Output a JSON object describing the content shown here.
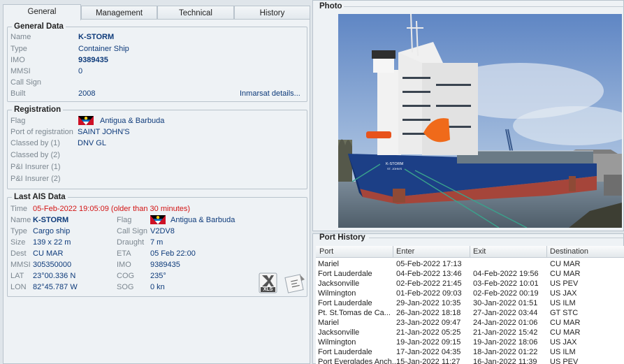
{
  "tabs": [
    "General",
    "Management",
    "Technical",
    "History"
  ],
  "general": {
    "legend": "General Data",
    "name_label": "Name",
    "name": "K-STORM",
    "type_label": "Type",
    "type": "Container Ship",
    "imo_label": "IMO",
    "imo": "9389435",
    "mmsi_label": "MMSI",
    "mmsi": "0",
    "callsign_label": "Call Sign",
    "callsign": "",
    "built_label": "Built",
    "built": "2008",
    "inmarsat_link": "Inmarsat details..."
  },
  "registration": {
    "legend": "Registration",
    "flag_label": "Flag",
    "flag": "Antigua & Barbuda",
    "port_label": "Port of registration",
    "port": "SAINT JOHN'S",
    "class1_label": "Classed by (1)",
    "class1": "DNV GL",
    "class2_label": "Classed by (2)",
    "class2": "",
    "pi1_label": "P&I Insurer (1)",
    "pi1": "",
    "pi2_label": "P&I Insurer (2)",
    "pi2": ""
  },
  "ais": {
    "legend": "Last AIS Data",
    "time_label": "Time",
    "time": "05-Feb-2022 19:05:09 (older than 30 minutes)",
    "name_label": "Name",
    "name": "K-STORM",
    "type_label": "Type",
    "type": "Cargo ship",
    "size_label": "Size",
    "size": "139 x 22 m",
    "dest_label": "Dest",
    "dest": "CU MAR",
    "mmsi_label": "MMSI",
    "mmsi": "305350000",
    "lat_label": "LAT",
    "lat": "23°00.336 N",
    "lon_label": "LON",
    "lon": "82°45.787 W",
    "flag_label": "Flag",
    "flag": "Antigua & Barbuda",
    "callsign_label": "Call Sign",
    "callsign": "V2DV8",
    "draught_label": "Draught",
    "draught": "7 m",
    "eta_label": "ETA",
    "eta": "05 Feb 22:00",
    "imo_label": "IMO",
    "imo": "9389435",
    "cog_label": "COG",
    "cog": "235°",
    "sog_label": "SOG",
    "sog": "0 kn",
    "xls_icon_label": "XLS"
  },
  "photo": {
    "header": "Photo",
    "hull_text": "K-STORM",
    "hull_port": "ST. JOHN'S"
  },
  "port_history": {
    "header": "Port History",
    "columns": [
      "Port",
      "Enter",
      "Exit",
      "Destination"
    ],
    "rows": [
      [
        "Mariel",
        "05-Feb-2022 17:13",
        "",
        "CU MAR"
      ],
      [
        "Fort Lauderdale",
        "04-Feb-2022 13:46",
        "04-Feb-2022 19:56",
        "CU MAR"
      ],
      [
        "Jacksonville",
        "02-Feb-2022 21:45",
        "03-Feb-2022 10:01",
        "US PEV"
      ],
      [
        "Wilmington",
        "01-Feb-2022 09:03",
        "02-Feb-2022 00:19",
        "US JAX"
      ],
      [
        "Fort Lauderdale",
        "29-Jan-2022 10:35",
        "30-Jan-2022 01:51",
        "US ILM"
      ],
      [
        "Pt. St.Tomas de Ca...",
        "26-Jan-2022 18:18",
        "27-Jan-2022 03:44",
        "GT STC"
      ],
      [
        "Mariel",
        "23-Jan-2022 09:47",
        "24-Jan-2022 01:06",
        "CU MAR"
      ],
      [
        "Jacksonville",
        "21-Jan-2022 05:25",
        "21-Jan-2022 15:42",
        "CU MAR"
      ],
      [
        "Wilmington",
        "19-Jan-2022 09:15",
        "19-Jan-2022 18:06",
        "US JAX"
      ],
      [
        "Fort Lauderdale",
        "17-Jan-2022 04:35",
        "18-Jan-2022 01:22",
        "US ILM"
      ],
      [
        "Port Everglades Anch...",
        "15-Jan-2022 11:27",
        "16-Jan-2022 11:39",
        "US PEV"
      ]
    ]
  }
}
